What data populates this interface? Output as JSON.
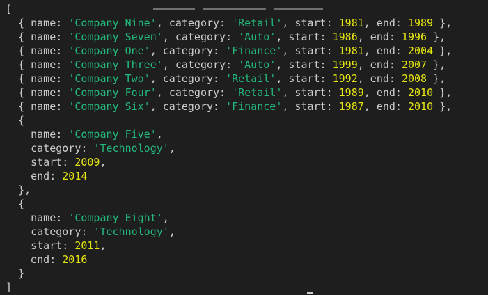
{
  "lines": [
    [
      {
        "t": "[",
        "c": "p"
      }
    ],
    [
      {
        "t": "  { name: ",
        "c": "p"
      },
      {
        "t": "'Company Nine'",
        "c": "s"
      },
      {
        "t": ", category: ",
        "c": "p"
      },
      {
        "t": "'Retail'",
        "c": "s"
      },
      {
        "t": ", start: ",
        "c": "p"
      },
      {
        "t": "1981",
        "c": "n"
      },
      {
        "t": ", end: ",
        "c": "p"
      },
      {
        "t": "1989",
        "c": "n"
      },
      {
        "t": " },",
        "c": "p"
      }
    ],
    [
      {
        "t": "  { name: ",
        "c": "p"
      },
      {
        "t": "'Company Seven'",
        "c": "s"
      },
      {
        "t": ", category: ",
        "c": "p"
      },
      {
        "t": "'Auto'",
        "c": "s"
      },
      {
        "t": ", start: ",
        "c": "p"
      },
      {
        "t": "1986",
        "c": "n"
      },
      {
        "t": ", end: ",
        "c": "p"
      },
      {
        "t": "1996",
        "c": "n"
      },
      {
        "t": " },",
        "c": "p"
      }
    ],
    [
      {
        "t": "  { name: ",
        "c": "p"
      },
      {
        "t": "'Company One'",
        "c": "s"
      },
      {
        "t": ", category: ",
        "c": "p"
      },
      {
        "t": "'Finance'",
        "c": "s"
      },
      {
        "t": ", start: ",
        "c": "p"
      },
      {
        "t": "1981",
        "c": "n"
      },
      {
        "t": ", end: ",
        "c": "p"
      },
      {
        "t": "2004",
        "c": "n"
      },
      {
        "t": " },",
        "c": "p"
      }
    ],
    [
      {
        "t": "  { name: ",
        "c": "p"
      },
      {
        "t": "'Company Three'",
        "c": "s"
      },
      {
        "t": ", category: ",
        "c": "p"
      },
      {
        "t": "'Auto'",
        "c": "s"
      },
      {
        "t": ", start: ",
        "c": "p"
      },
      {
        "t": "1999",
        "c": "n"
      },
      {
        "t": ", end: ",
        "c": "p"
      },
      {
        "t": "2007",
        "c": "n"
      },
      {
        "t": " },",
        "c": "p"
      }
    ],
    [
      {
        "t": "  { name: ",
        "c": "p"
      },
      {
        "t": "'Company Two'",
        "c": "s"
      },
      {
        "t": ", category: ",
        "c": "p"
      },
      {
        "t": "'Retail'",
        "c": "s"
      },
      {
        "t": ", start: ",
        "c": "p"
      },
      {
        "t": "1992",
        "c": "n"
      },
      {
        "t": ", end: ",
        "c": "p"
      },
      {
        "t": "2008",
        "c": "n"
      },
      {
        "t": " },",
        "c": "p"
      }
    ],
    [
      {
        "t": "  { name: ",
        "c": "p"
      },
      {
        "t": "'Company Four'",
        "c": "s"
      },
      {
        "t": ", category: ",
        "c": "p"
      },
      {
        "t": "'Retail'",
        "c": "s"
      },
      {
        "t": ", start: ",
        "c": "p"
      },
      {
        "t": "1989",
        "c": "n"
      },
      {
        "t": ", end: ",
        "c": "p"
      },
      {
        "t": "2010",
        "c": "n"
      },
      {
        "t": " },",
        "c": "p"
      }
    ],
    [
      {
        "t": "  { name: ",
        "c": "p"
      },
      {
        "t": "'Company Six'",
        "c": "s"
      },
      {
        "t": ", category: ",
        "c": "p"
      },
      {
        "t": "'Finance'",
        "c": "s"
      },
      {
        "t": ", start: ",
        "c": "p"
      },
      {
        "t": "1987",
        "c": "n"
      },
      {
        "t": ", end: ",
        "c": "p"
      },
      {
        "t": "2010",
        "c": "n"
      },
      {
        "t": " },",
        "c": "p"
      }
    ],
    [
      {
        "t": "  {",
        "c": "p"
      }
    ],
    [
      {
        "t": "    name: ",
        "c": "p"
      },
      {
        "t": "'Company Five'",
        "c": "s"
      },
      {
        "t": ",",
        "c": "p"
      }
    ],
    [
      {
        "t": "    category: ",
        "c": "p"
      },
      {
        "t": "'Technology'",
        "c": "s"
      },
      {
        "t": ",",
        "c": "p"
      }
    ],
    [
      {
        "t": "    start: ",
        "c": "p"
      },
      {
        "t": "2009",
        "c": "n"
      },
      {
        "t": ",",
        "c": "p"
      }
    ],
    [
      {
        "t": "    end: ",
        "c": "p"
      },
      {
        "t": "2014",
        "c": "n"
      }
    ],
    [
      {
        "t": "  },",
        "c": "p"
      }
    ],
    [
      {
        "t": "  {",
        "c": "p"
      }
    ],
    [
      {
        "t": "    name: ",
        "c": "p"
      },
      {
        "t": "'Company Eight'",
        "c": "s"
      },
      {
        "t": ",",
        "c": "p"
      }
    ],
    [
      {
        "t": "    category: ",
        "c": "p"
      },
      {
        "t": "'Technology'",
        "c": "s"
      },
      {
        "t": ",",
        "c": "p"
      }
    ],
    [
      {
        "t": "    start: ",
        "c": "p"
      },
      {
        "t": "2011",
        "c": "n"
      },
      {
        "t": ",",
        "c": "p"
      }
    ],
    [
      {
        "t": "    end: ",
        "c": "p"
      },
      {
        "t": "2016",
        "c": "n"
      }
    ],
    [
      {
        "t": "  }",
        "c": "p"
      }
    ],
    [
      {
        "t": "]",
        "c": "p"
      }
    ]
  ],
  "colors": {
    "background": "#1e1e1e",
    "punctuation": "#cccccc",
    "string": "#23b97b",
    "number": "#e5e510"
  }
}
